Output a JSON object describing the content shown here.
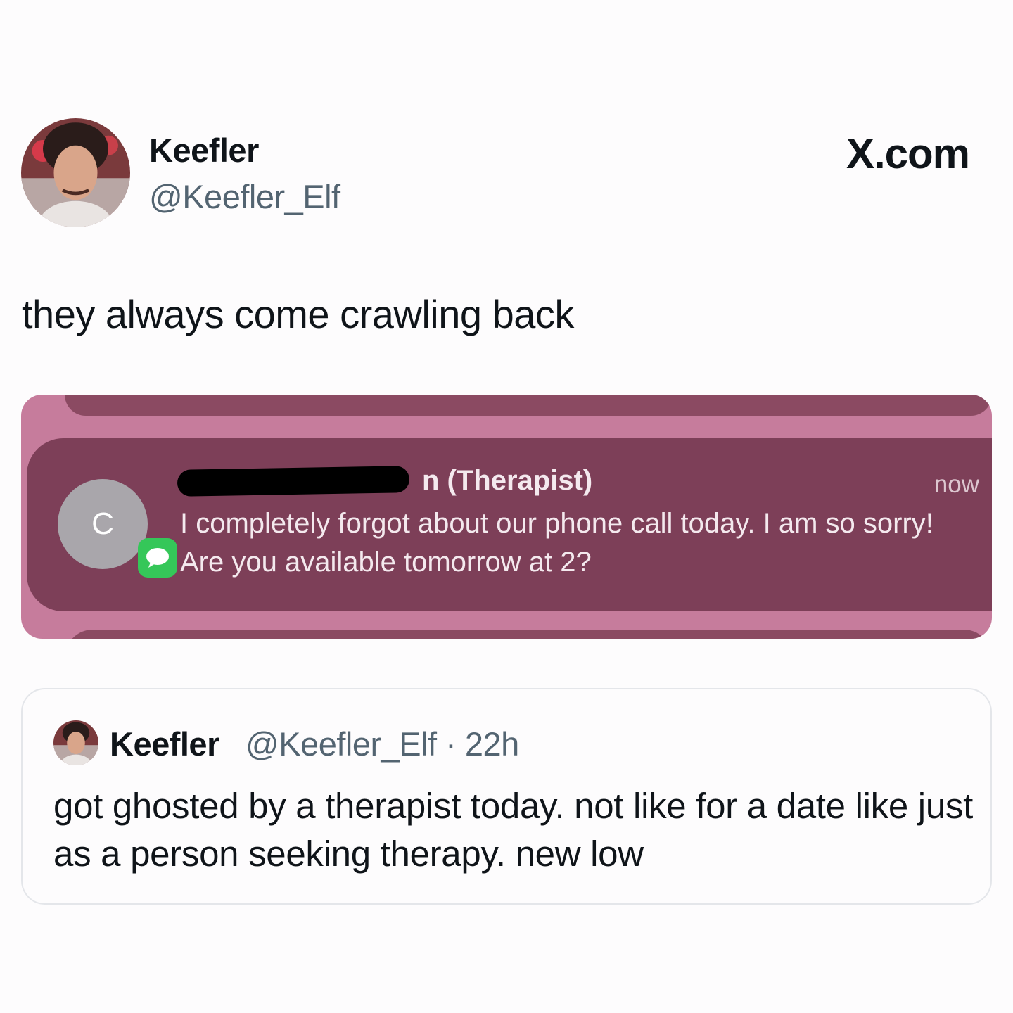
{
  "post": {
    "author_name": "Keefler",
    "author_handle": "@Keefler_Elf",
    "brand": "X.com",
    "text": "they always come crawling back",
    "avatar_icon": "profile-photo-avatar"
  },
  "notification": {
    "sender_suffix": "n (Therapist)",
    "time": "now",
    "body": "I completely forgot about our phone call today. I am so sorry! Are you available tomorrow at 2?",
    "contact_initial": "C",
    "app_icon": "messages-icon",
    "colors": {
      "background": "#c67c9c",
      "card": "#7d3f58",
      "badge": "#35c759"
    }
  },
  "quoted_post": {
    "author_name": "Keefler",
    "meta": "@Keefler_Elf · 22h",
    "text": "got ghosted by a therapist today. not like for a date like just as a person seeking therapy. new low"
  }
}
